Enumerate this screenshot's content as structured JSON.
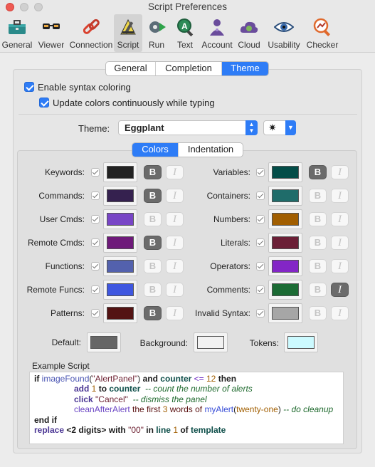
{
  "window": {
    "title": "Script Preferences"
  },
  "toolbar": [
    {
      "label": "General",
      "icon": "toolbox-icon"
    },
    {
      "label": "Viewer",
      "icon": "glasses-icon"
    },
    {
      "label": "Connection",
      "icon": "chain-link-icon"
    },
    {
      "label": "Script",
      "icon": "pencil-script-icon"
    },
    {
      "label": "Run",
      "icon": "gear-run-icon"
    },
    {
      "label": "Text",
      "icon": "text-magnifier-icon"
    },
    {
      "label": "Account",
      "icon": "person-icon"
    },
    {
      "label": "Cloud",
      "icon": "cloud-icon"
    },
    {
      "label": "Usability",
      "icon": "eye-icon"
    },
    {
      "label": "Checker",
      "icon": "checker-icon"
    }
  ],
  "toolbar_selected": "Script",
  "tabs": {
    "items": [
      "General",
      "Completion",
      "Theme"
    ],
    "selected": "Theme"
  },
  "options": {
    "syntax_coloring": "Enable syntax coloring",
    "update_colors": "Update colors continuously while typing"
  },
  "theme": {
    "label": "Theme:",
    "value": "Eggplant",
    "star": "✷"
  },
  "subtabs": {
    "items": [
      "Colors",
      "Indentation"
    ],
    "selected": "Colors"
  },
  "colors": {
    "left": [
      {
        "label": "Keywords:",
        "color": "#222222",
        "bold": true,
        "italic": false
      },
      {
        "label": "Commands:",
        "color": "#35214f",
        "bold": true,
        "italic": false
      },
      {
        "label": "User Cmds:",
        "color": "#7845c6",
        "bold": false,
        "italic": false
      },
      {
        "label": "Remote Cmds:",
        "color": "#6e1a7a",
        "bold": true,
        "italic": false
      },
      {
        "label": "Functions:",
        "color": "#5361ad",
        "bold": false,
        "italic": false
      },
      {
        "label": "Remote Funcs:",
        "color": "#3f57e0",
        "bold": false,
        "italic": false
      },
      {
        "label": "Patterns:",
        "color": "#531313",
        "bold": true,
        "italic": false
      }
    ],
    "right": [
      {
        "label": "Variables:",
        "color": "#034d48",
        "bold": true,
        "italic": false
      },
      {
        "label": "Containers:",
        "color": "#1f6c6a",
        "bold": false,
        "italic": false
      },
      {
        "label": "Numbers:",
        "color": "#a15e00",
        "bold": false,
        "italic": false
      },
      {
        "label": "Literals:",
        "color": "#6b1f36",
        "bold": false,
        "italic": false
      },
      {
        "label": "Operators:",
        "color": "#8326c6",
        "bold": false,
        "italic": false
      },
      {
        "label": "Comments:",
        "color": "#1b6b34",
        "bold": false,
        "italic": true
      },
      {
        "label": "Invalid Syntax:",
        "color": "#a6a6a6",
        "bold": false,
        "italic": false
      }
    ],
    "default": {
      "label": "Default:",
      "color": "#666666"
    },
    "background": {
      "label": "Background:",
      "color": "#f2f2f2"
    },
    "tokens": {
      "label": "Tokens:",
      "color": "#ccfaff"
    },
    "bold_glyph": "B",
    "italic_glyph": "I"
  },
  "example": {
    "label": "Example Script",
    "line1": {
      "a": "if ",
      "b": "imageFound",
      "c": "(",
      "d": "\"AlertPanel\"",
      "e": ") ",
      "f": "and ",
      "g": "counter",
      "h": " <= ",
      "i": "12",
      "j": " then"
    },
    "line2": {
      "a": "add ",
      "b": "1",
      "c": " to ",
      "d": "counter",
      "e": "  -- count the number of alerts"
    },
    "line3": {
      "a": "click ",
      "b": "\"Cancel\"",
      "c": "  -- dismiss the panel"
    },
    "line4": {
      "a": "cleanAfterAlert",
      "b": " the first ",
      "c": "3",
      "d": " words of ",
      "e": "myAlert",
      "f": "(",
      "g": "twenty-one",
      "h": ")",
      "i": " -- do cleanup"
    },
    "line5": {
      "a": "end if"
    },
    "line6": {
      "a": "replace ",
      "b": "<2 digits>",
      "c": " with ",
      "d": "\"00\"",
      "e": " in ",
      "f": "line ",
      "g": "1",
      "h": " of ",
      "i": "template"
    }
  }
}
